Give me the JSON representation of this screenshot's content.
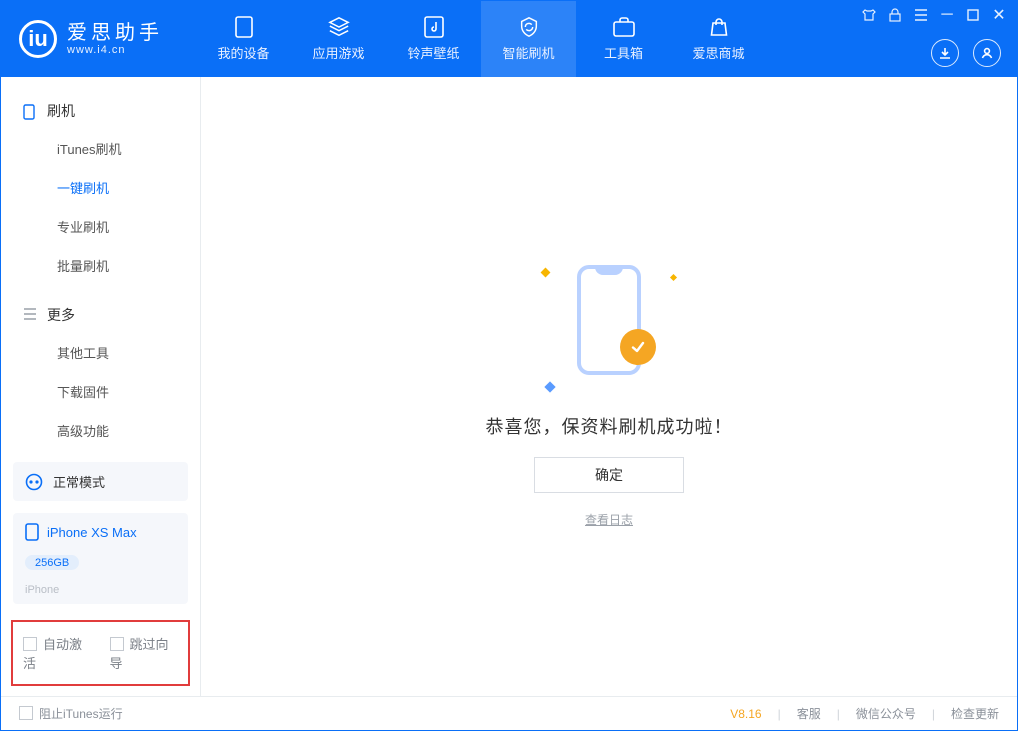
{
  "app": {
    "name": "爱思助手",
    "url": "www.i4.cn"
  },
  "header": {
    "tabs": [
      {
        "label": "我的设备",
        "icon": "device-icon"
      },
      {
        "label": "应用游戏",
        "icon": "cube-icon"
      },
      {
        "label": "铃声壁纸",
        "icon": "music-icon"
      },
      {
        "label": "智能刷机",
        "icon": "refresh-icon",
        "active": true
      },
      {
        "label": "工具箱",
        "icon": "toolbox-icon"
      },
      {
        "label": "爱思商城",
        "icon": "store-icon"
      }
    ]
  },
  "sidebar": {
    "section_flash": "刷机",
    "flash_items": [
      "iTunes刷机",
      "一键刷机",
      "专业刷机",
      "批量刷机"
    ],
    "flash_selected_index": 1,
    "section_more": "更多",
    "more_items": [
      "其他工具",
      "下载固件",
      "高级功能"
    ],
    "mode_label": "正常模式",
    "device": {
      "name": "iPhone XS Max",
      "capacity": "256GB",
      "subtitle": "iPhone"
    },
    "checkbox_auto_activate": "自动激活",
    "checkbox_skip_guide": "跳过向导"
  },
  "main": {
    "success_message": "恭喜您，保资料刷机成功啦！",
    "confirm_label": "确定",
    "view_log_label": "查看日志"
  },
  "footer": {
    "block_itunes": "阻止iTunes运行",
    "version": "V8.16",
    "links": [
      "客服",
      "微信公众号",
      "检查更新"
    ]
  }
}
